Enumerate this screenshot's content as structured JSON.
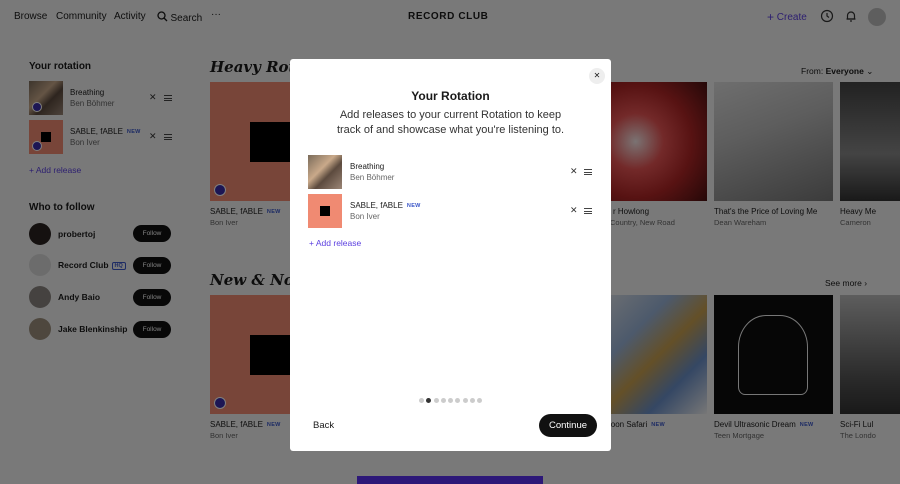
{
  "nav": {
    "links": [
      "Browse",
      "Community",
      "Activity"
    ],
    "search_label": "Search",
    "more_label": "···",
    "logo": "RECORD CLUB",
    "create_label": "Create"
  },
  "sidebar": {
    "rotation_heading": "Your rotation",
    "rotation": [
      {
        "title": "Breathing",
        "artist": "Ben Böhmer",
        "is_new": false
      },
      {
        "title": "SABLE, fABLE",
        "artist": "Bon Iver",
        "is_new": true
      }
    ],
    "add_release": "Add release",
    "follow_heading": "Who to follow",
    "follow": [
      {
        "name": "probertoj",
        "hq": false
      },
      {
        "name": "Record Club",
        "hq": true
      },
      {
        "name": "Andy Baio",
        "hq": false
      },
      {
        "name": "Jake Blenkinship",
        "hq": false
      }
    ],
    "follow_label": "Follow",
    "hq_label": "HQ"
  },
  "new_badge": "NEW",
  "main": {
    "heavy_title": "Heavy Rotation",
    "from_label": "From:",
    "from_value": "Everyone",
    "heavy_cards": [
      {
        "title": "SABLE, fABLE",
        "artist": "Bon Iver",
        "is_new": true
      },
      {
        "title": "r Howlong",
        "artist": "Country, New Road",
        "is_new": false
      },
      {
        "title": "That's the Price of Loving Me",
        "artist": "Dean Wareham",
        "is_new": false
      },
      {
        "title": "Heavy Me",
        "artist": "Cameron",
        "is_new": false
      }
    ],
    "new_title": "New & Noteworthy",
    "see_more": "See more",
    "new_cards": [
      {
        "title": "SABLE, fABLE",
        "artist": "Bon Iver",
        "is_new": true
      },
      {
        "title": "loon Safari",
        "artist": "",
        "is_new": true
      },
      {
        "title": "Devil Ultrasonic Dream",
        "artist": "Teen Mortgage",
        "is_new": true
      },
      {
        "title": "Sci-Fi Lul",
        "artist": "The Londo",
        "is_new": false
      }
    ]
  },
  "modal": {
    "title": "Your Rotation",
    "subtitle": "Add releases to your current Rotation to keep track of and showcase what you're listening to.",
    "items": [
      {
        "title": "Breathing",
        "artist": "Ben Böhmer",
        "is_new": false
      },
      {
        "title": "SABLE, fABLE",
        "artist": "Bon Iver",
        "is_new": true
      }
    ],
    "add_release": "Add release",
    "back_label": "Back",
    "continue_label": "Continue",
    "step_count": 9,
    "current_step": 2
  },
  "colors": {
    "accent": "#5b3fe0",
    "overlay": "rgba(0,0,0,0.5)",
    "sable_bg": "#f08a72"
  }
}
